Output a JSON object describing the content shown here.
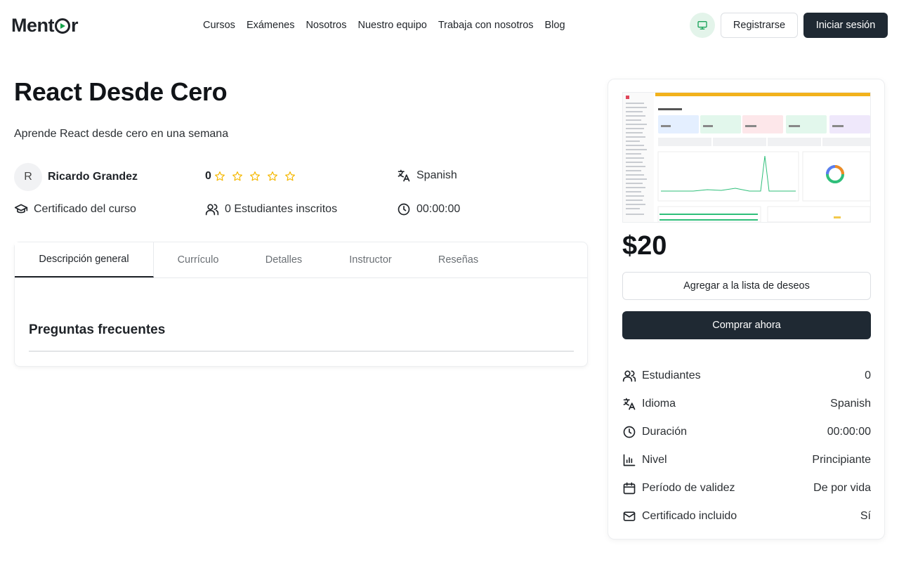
{
  "brand": {
    "name_prefix": "Ment",
    "name_suffix": "r"
  },
  "nav": {
    "items": [
      "Cursos",
      "Exámenes",
      "Nosotros",
      "Nuestro equipo",
      "Trabaja con nosotros",
      "Blog"
    ]
  },
  "header": {
    "register_label": "Registrarse",
    "login_label": "Iniciar sesión",
    "monitor_icon": "monitor-icon"
  },
  "course": {
    "title": "React Desde Cero",
    "subtitle": "Aprende React desde cero en una semana",
    "instructor_initial": "R",
    "instructor_name": "Ricardo Grandez",
    "rating": "0",
    "rating_stars_filled": 0,
    "rating_stars_total": 5,
    "language": "Spanish",
    "certificate_label": "Certificado del curso",
    "students_label": "0 Estudiantes inscritos",
    "duration": "00:00:00"
  },
  "tabs": [
    {
      "label": "Descripción general",
      "active": true
    },
    {
      "label": "Currículo",
      "active": false
    },
    {
      "label": "Detalles",
      "active": false
    },
    {
      "label": "Instructor",
      "active": false
    },
    {
      "label": "Reseñas",
      "active": false
    }
  ],
  "faq": {
    "title": "Preguntas frecuentes"
  },
  "sidebar": {
    "price": "$20",
    "wishlist_label": "Agregar a la lista de deseos",
    "buy_label": "Comprar ahora",
    "info": [
      {
        "icon": "users-icon",
        "label": "Estudiantes",
        "value": "0"
      },
      {
        "icon": "translate-icon",
        "label": "Idioma",
        "value": "Spanish"
      },
      {
        "icon": "clock-icon",
        "label": "Duración",
        "value": "00:00:00"
      },
      {
        "icon": "bar-chart-icon",
        "label": "Nivel",
        "value": "Principiante"
      },
      {
        "icon": "calendar-icon",
        "label": "Período de validez",
        "value": "De por vida"
      },
      {
        "icon": "mail-icon",
        "label": "Certificado incluido",
        "value": "Sí"
      }
    ]
  },
  "colors": {
    "accent": "#1f2933",
    "star": "#f5b800",
    "monitor_bg": "#e3f4ea",
    "monitor_icon": "#1aa35a"
  }
}
